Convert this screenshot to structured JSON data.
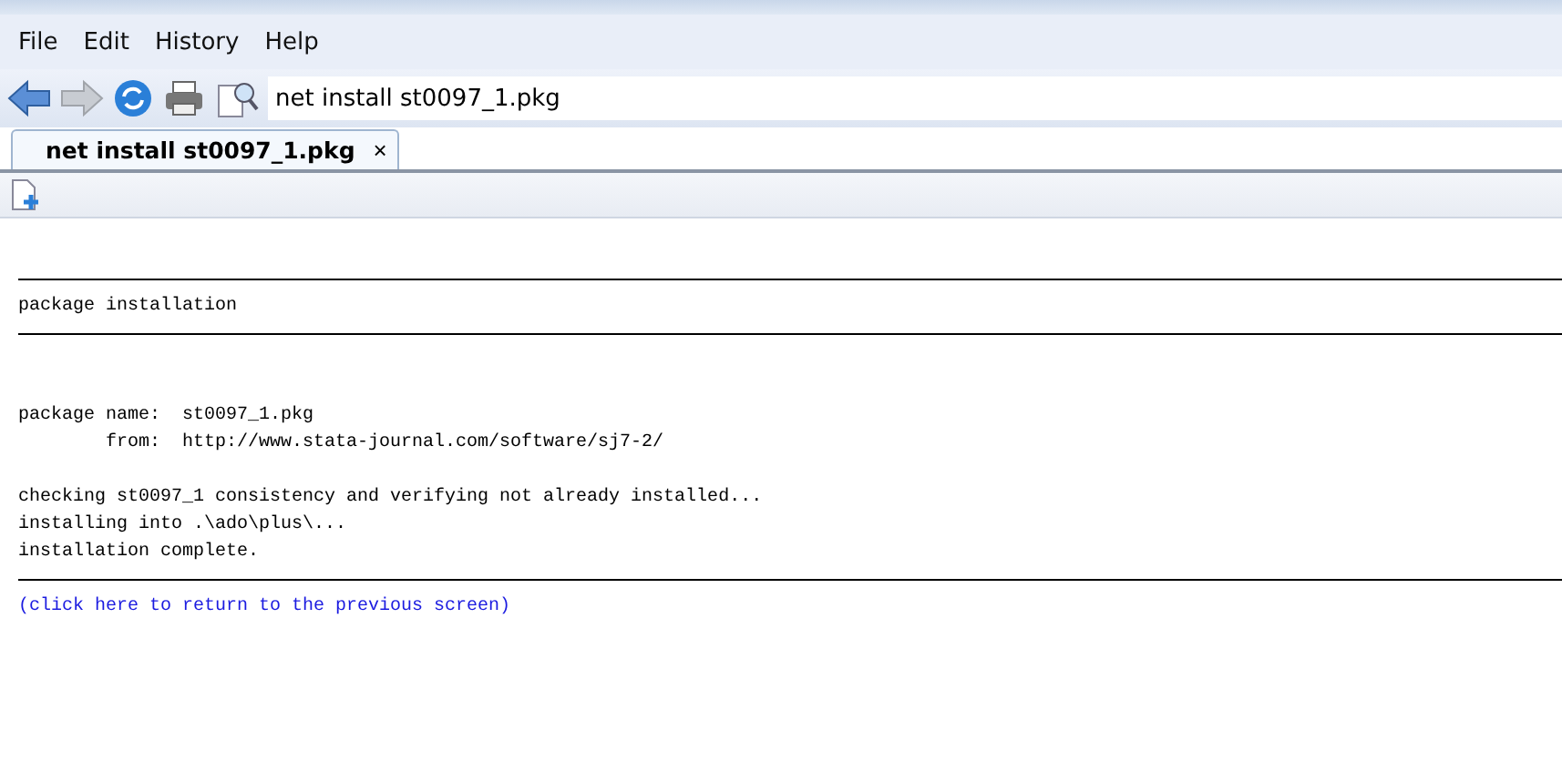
{
  "menu": [
    "File",
    "Edit",
    "History",
    "Help"
  ],
  "address": {
    "value": "net install st0097_1.pkg"
  },
  "tabs": [
    {
      "label": "net install st0097_1.pkg",
      "close": "×",
      "selected": true
    }
  ],
  "content": [
    {
      "kind": "rule"
    },
    {
      "kind": "text",
      "text": "package installation"
    },
    {
      "kind": "rule"
    },
    {
      "kind": "blank"
    },
    {
      "kind": "blank"
    },
    {
      "kind": "text",
      "text": "package name:  st0097_1.pkg"
    },
    {
      "kind": "text",
      "text": "        from:  http://www.stata-journal.com/software/sj7-2/"
    },
    {
      "kind": "blank"
    },
    {
      "kind": "text",
      "text": "checking st0097_1 consistency and verifying not already installed..."
    },
    {
      "kind": "text",
      "text": "installing into .\\ado\\plus\\..."
    },
    {
      "kind": "text",
      "text": "installation complete."
    },
    {
      "kind": "rule"
    },
    {
      "kind": "link",
      "text": "(click here to return to the previous screen)"
    }
  ]
}
